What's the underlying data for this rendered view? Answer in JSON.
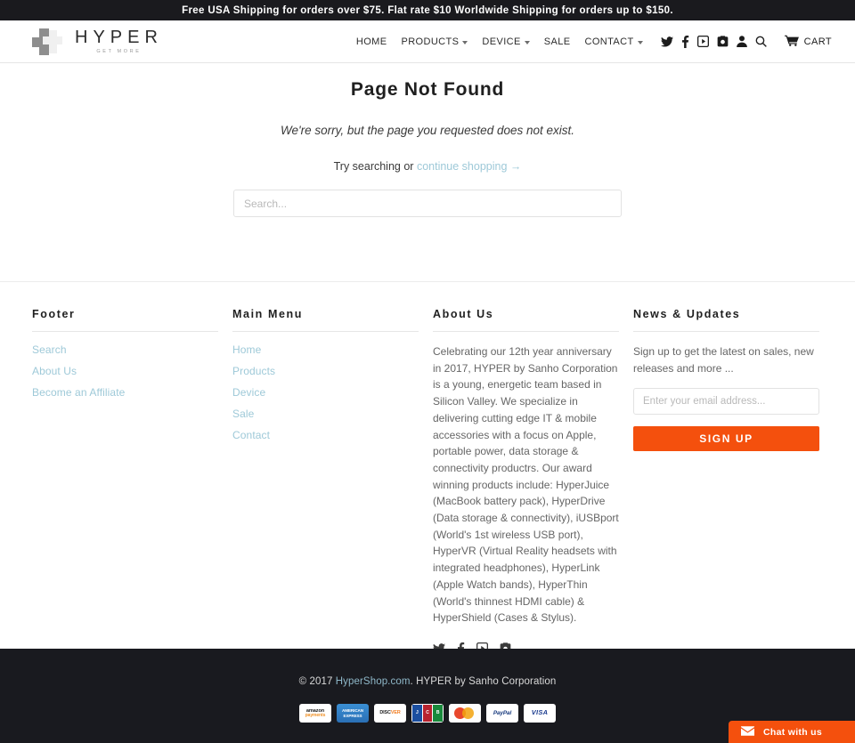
{
  "announcement": {
    "text": "Free USA Shipping for orders over $75. Flat rate $10 Worldwide Shipping for orders up to $150."
  },
  "header": {
    "logo_word": "HYPER",
    "logo_tagline": "GET MORE",
    "nav": [
      {
        "label": "HOME",
        "has_caret": false
      },
      {
        "label": "PRODUCTS",
        "has_caret": true
      },
      {
        "label": "DEVICE",
        "has_caret": true
      },
      {
        "label": "SALE",
        "has_caret": false
      },
      {
        "label": "CONTACT",
        "has_caret": true
      }
    ],
    "social": [
      "twitter-icon",
      "facebook-icon",
      "youtube-icon",
      "instagram-icon"
    ],
    "account_icon": "person-icon",
    "search_icon": "search-icon",
    "cart_icon": "cart-icon",
    "cart_label": "CART"
  },
  "main": {
    "title": "Page Not Found",
    "message": "We're sorry, but the page you requested does not exist.",
    "try_prefix": "Try searching or ",
    "continue_link": "continue shopping →",
    "search_placeholder": "Search...",
    "search_value": ""
  },
  "footer": {
    "columns": [
      {
        "heading": "Footer",
        "links": [
          "Search",
          "About Us",
          "Become an Affiliate"
        ]
      },
      {
        "heading": "Main Menu",
        "links": [
          "Home",
          "Products",
          "Device",
          "Sale",
          "Contact"
        ]
      }
    ],
    "about": {
      "heading": "About Us",
      "body": "Celebrating our 12th year anniversary in 2017, HYPER by Sanho Corporation is a young, energetic team based in Silicon Valley. We specialize in delivering cutting edge IT & mobile accessories with a focus on Apple, portable power, data storage & connectivity productrs. Our award winning products include: HyperJuice (MacBook battery pack), HyperDrive (Data storage & connectivity), iUSBport (World's 1st wireless USB port), HyperVR (Virtual Reality headsets with integrated headphones), HyperLink (Apple Watch bands), HyperThin (World's thinnest HDMI cable) & HyperShield (Cases & Stylus).",
      "social": [
        "twitter-icon",
        "facebook-icon",
        "youtube-icon",
        "instagram-icon"
      ]
    },
    "news": {
      "heading": "News & Updates",
      "body": "Sign up to get the latest on sales, new releases and more ...",
      "email_placeholder": "Enter your email address...",
      "email_value": "",
      "signup_label": "SIGN UP",
      "signup_color": "#f4500d"
    }
  },
  "bottom": {
    "copyright_prefix": "© 2017 ",
    "copyright_link": "HyperShop.com",
    "copyright_suffix": ". HYPER by Sanho Corporation",
    "payments": [
      {
        "name": "amazon-payments",
        "top": "amazon",
        "sub": "payments"
      },
      {
        "name": "american-express",
        "label": "AMERICAN EXPRESS"
      },
      {
        "name": "discover",
        "label": "DISC",
        "accent": "VER"
      },
      {
        "name": "jcb",
        "label": "JCB"
      },
      {
        "name": "mastercard",
        "label": "MasterCard"
      },
      {
        "name": "paypal",
        "label": "PayPal"
      },
      {
        "name": "visa",
        "label": "VISA"
      }
    ]
  },
  "chat": {
    "label": "Chat with us",
    "icon": "envelope-icon",
    "color": "#f4500d"
  }
}
